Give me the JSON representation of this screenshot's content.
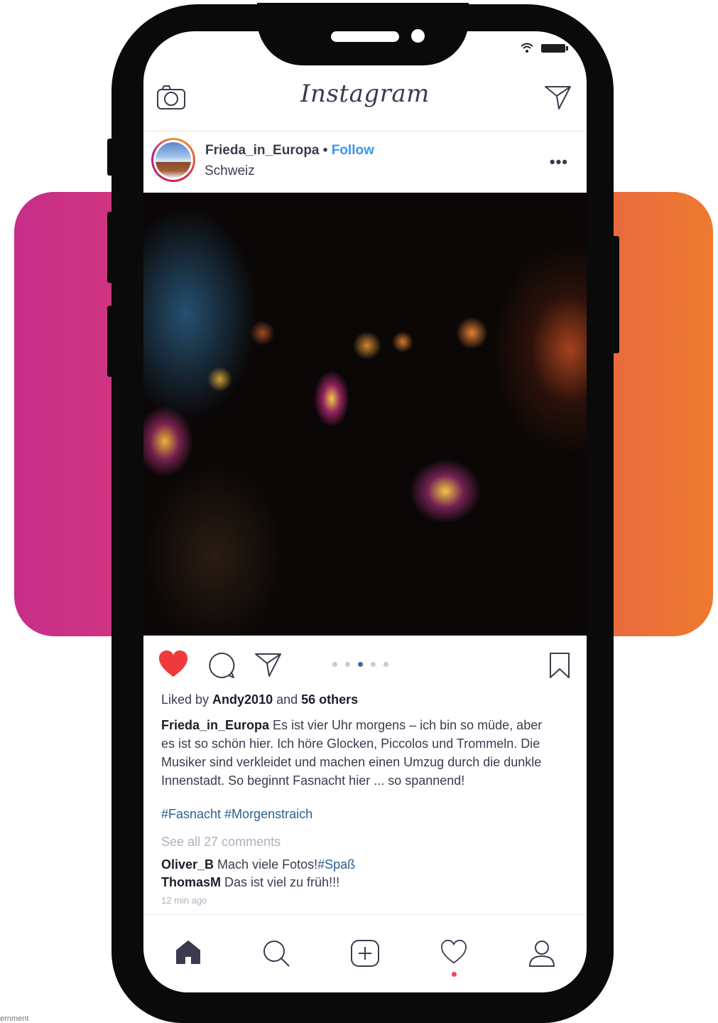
{
  "status_bar": {
    "wifi_icon": "wifi-icon",
    "battery_icon": "battery-icon"
  },
  "header": {
    "logo": "Instagram",
    "camera_icon": "camera-icon",
    "direct_icon": "paper-plane-icon"
  },
  "post": {
    "username": "Frieda_in_Europa",
    "separator": "•",
    "follow_label": "Follow",
    "location": "Schweiz",
    "more_label": "•••",
    "carousel": {
      "count": 5,
      "active_index": 2
    },
    "liked_prefix": "Liked by ",
    "liked_user": "Andy2010",
    "liked_and": " and ",
    "liked_others": "56 others",
    "caption_user": "Frieda_in_Europa",
    "caption_text": " Es ist vier Uhr morgens – ich bin so müde, aber es ist so schön hier. Ich höre Glocken, Piccolos und Trommeln. Die Musiker sind verkleidet und machen einen Umzug durch die dunkle Innenstadt. So beginnt Fasnacht hier ... so spannend!",
    "hashtags": "#Fasnacht #Morgenstraich",
    "see_all": "See all 27 comments",
    "comments": [
      {
        "user": "Oliver_B",
        "text": " Mach viele Fotos!",
        "tag": "#Spaß"
      },
      {
        "user": "ThomasM",
        "text": " Das ist viel zu früh!!!",
        "tag": ""
      }
    ],
    "time": "12 min ago",
    "liked": true,
    "colors": {
      "heart": "#ed3b3b",
      "follow": "#3897f0",
      "hashtag": "#2b5f8f"
    }
  },
  "nav": [
    "home-icon",
    "search-icon",
    "add-post-icon",
    "activity-heart-icon",
    "profile-icon"
  ],
  "footer_note": "ernment"
}
